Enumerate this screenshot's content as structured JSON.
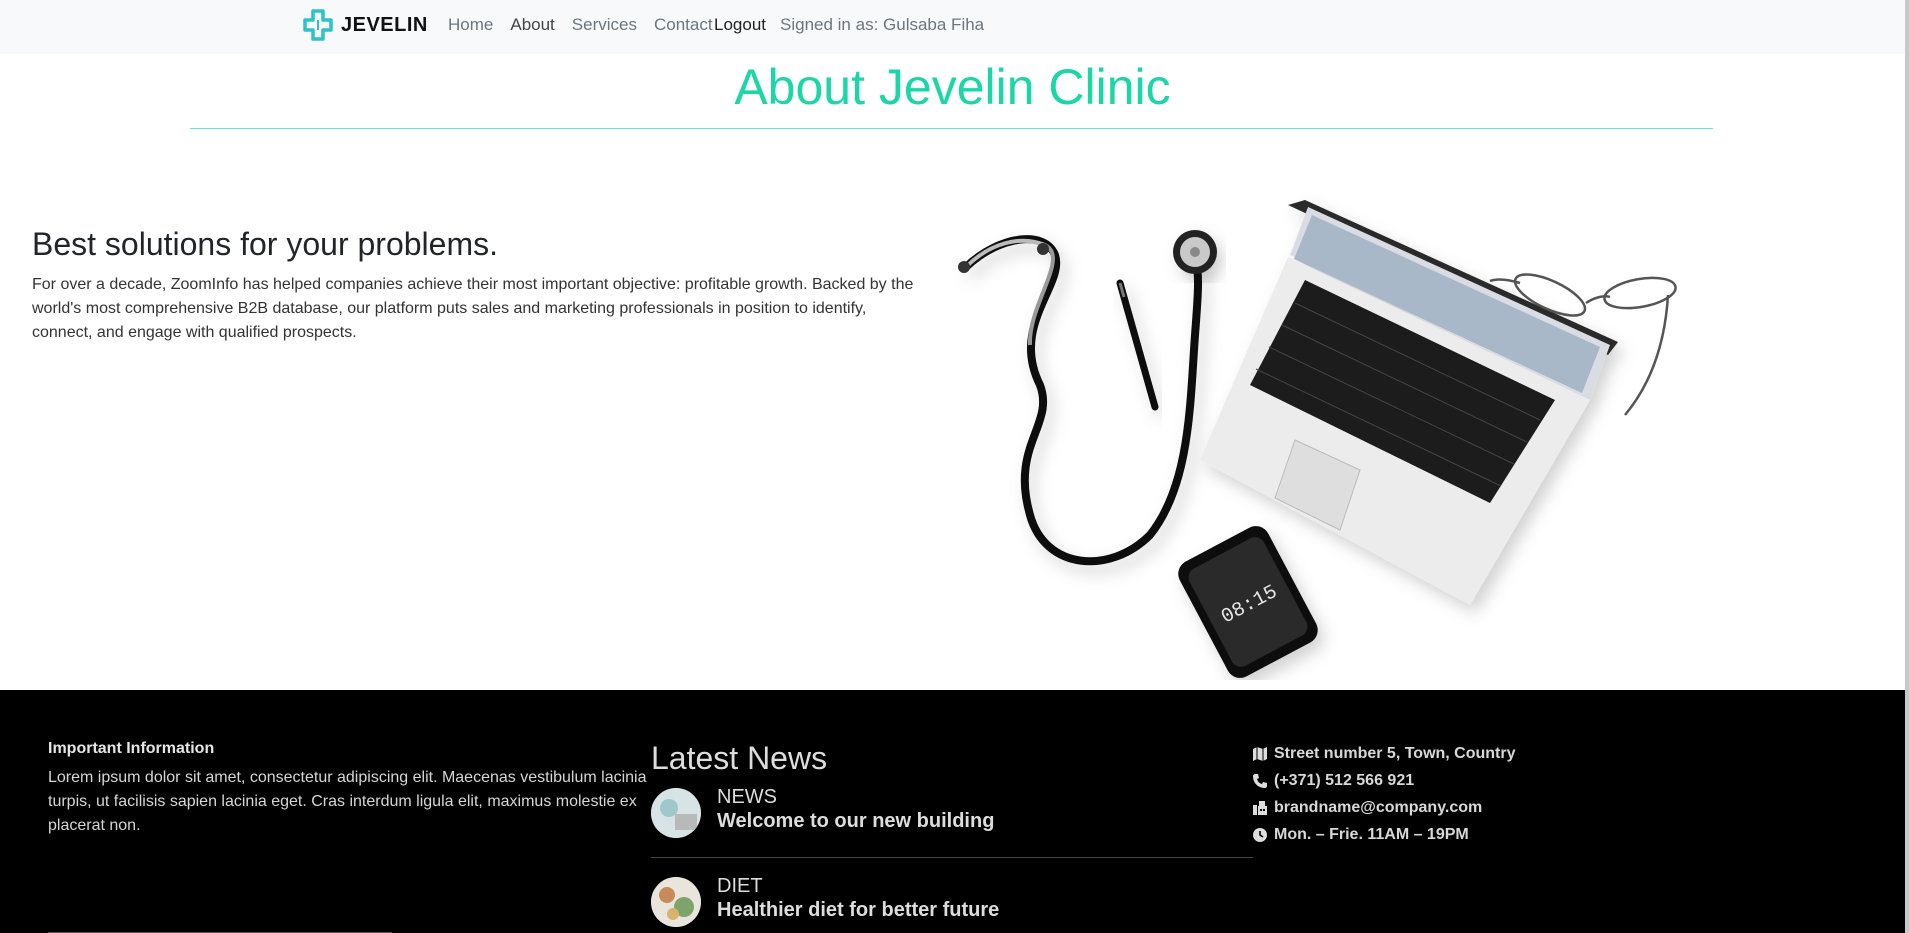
{
  "nav": {
    "brand": "JEVELIN",
    "links": [
      "Home",
      "About",
      "Services",
      "Contact"
    ],
    "logout": "Logout",
    "signed_in": "Signed in as: Gulsaba Fiha"
  },
  "hero": {
    "title": "About Jevelin Clinic",
    "headline": "Best solutions for your problems.",
    "intro": "For over a decade, ZoomInfo has helped companies achieve their most important objective: profitable growth. Backed by the world's most comprehensive B2B database, our platform puts sales and marketing professionals in position to identify, connect, and engage with qualified prospects.",
    "phone_time": "08:15"
  },
  "footer": {
    "info_title": "Important Information",
    "info_text": "Lorem ipsum dolor sit amet, consectetur adipiscing elit. Maecenas vestibulum lacinia turpis, ut facilisis sapien lacinia eget. Cras interdum ligula elit, maximus molestie ex placerat non.",
    "news_title": "Latest News",
    "news": [
      {
        "category": "NEWS",
        "headline": "Welcome to our new building"
      },
      {
        "category": "DIET",
        "headline": "Healthier diet for better future"
      }
    ],
    "contact": {
      "address": "Street number 5, Town, Country",
      "phone": "(+371) 512 566 921",
      "email": "brandname@company.com",
      "hours": "Mon. – Frie. 11AM – 19PM"
    }
  },
  "colors": {
    "accent": "#1bd6a6",
    "logo": "#2bc3c9",
    "navbar_bg": "#f8f9fa",
    "footer_bg": "#000000"
  },
  "icons": [
    "medical-cross-logo-icon",
    "map-icon",
    "phone-icon",
    "fax-icon",
    "clock-icon"
  ]
}
